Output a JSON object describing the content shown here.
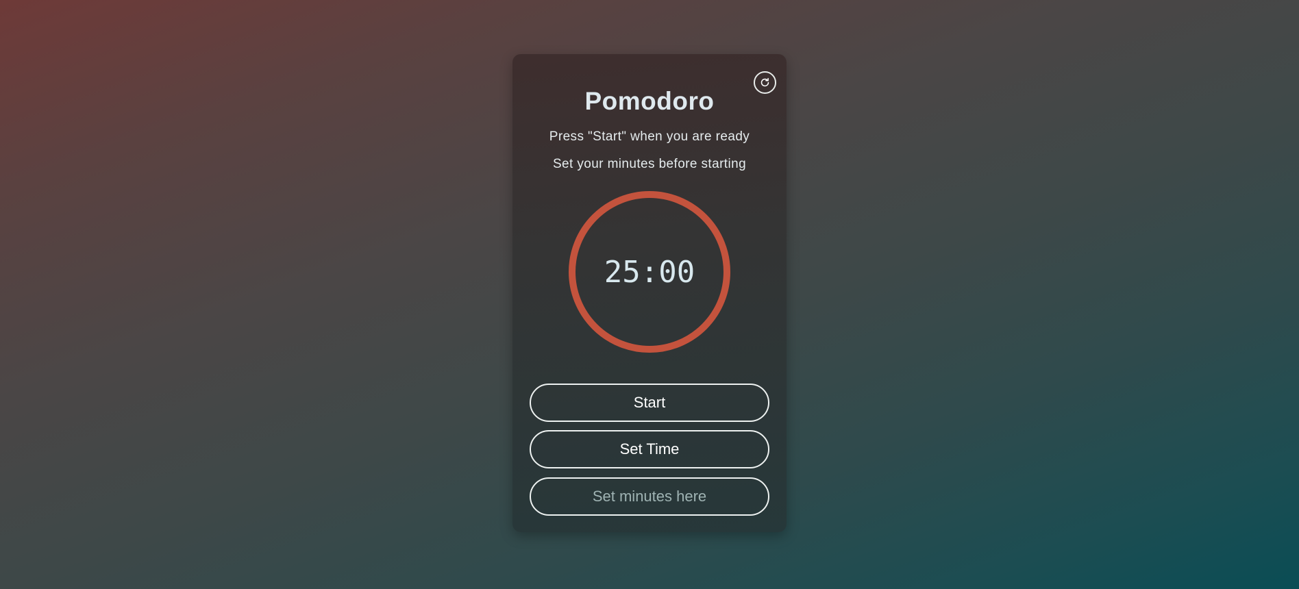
{
  "app": {
    "title": "Pomodoro",
    "instruction_1": "Press \"Start\" when you are ready",
    "instruction_2": "Set your minutes before starting"
  },
  "timer": {
    "display": "25:00",
    "progress_fraction": 1.0,
    "ring_color": "#c4533d"
  },
  "controls": {
    "start_label": "Start",
    "set_time_label": "Set Time",
    "minutes_input_value": "",
    "minutes_input_placeholder": "Set minutes here"
  },
  "icons": {
    "reset": "refresh-icon"
  }
}
